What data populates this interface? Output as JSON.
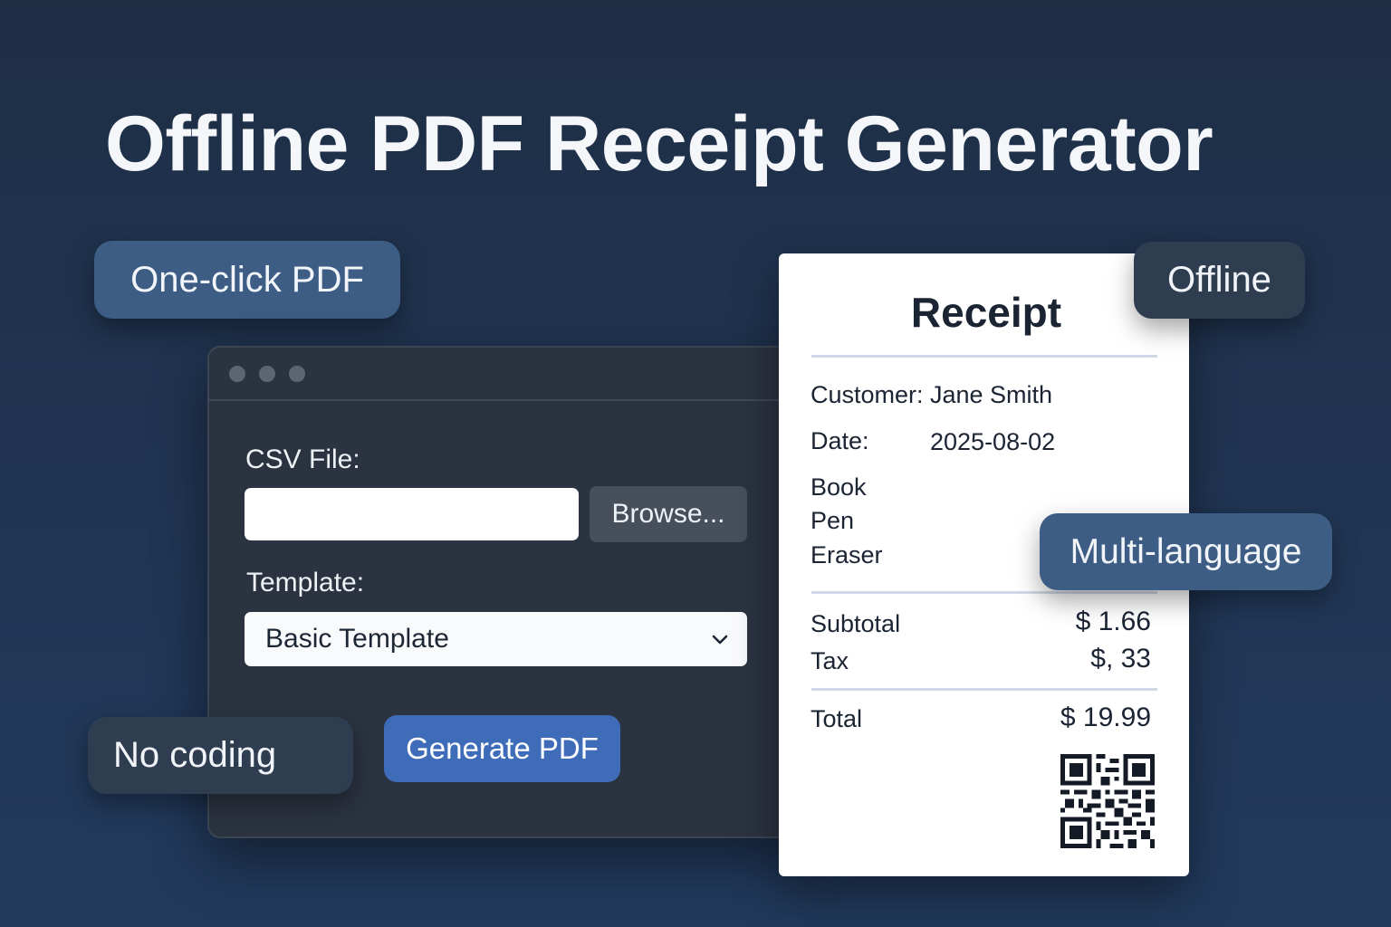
{
  "title": "Offline PDF Receipt Generator",
  "badges": {
    "one_click": "One-click PDF",
    "offline": "Offline",
    "multi_language": "Multi-language",
    "no_coding": "No coding"
  },
  "app_window": {
    "csv_label": "CSV File:",
    "csv_value": "",
    "browse_label": "Browse...",
    "template_label": "Template:",
    "template_selected": "Basic Template",
    "generate_label": "Generate PDF"
  },
  "receipt": {
    "title": "Receipt",
    "customer_label": "Customer:",
    "customer_value": "Jane Smith",
    "date_label": "Date:",
    "date_value": "2025-08-02",
    "items": [
      "Book",
      "Pen",
      "Eraser"
    ],
    "subtotal_label": "Subtotal",
    "subtotal_value": "$ 1.66",
    "tax_label": "Tax",
    "tax_value": "$, 33",
    "total_label": "Total",
    "total_value": "$ 19.99",
    "qr_icon": "qr-code-icon"
  },
  "colors": {
    "background": "#1f3350",
    "primary_button": "#3e6cb8",
    "badge_blue": "#3d5d84",
    "badge_dark": "#2e3d50",
    "window": "#2b3340"
  }
}
